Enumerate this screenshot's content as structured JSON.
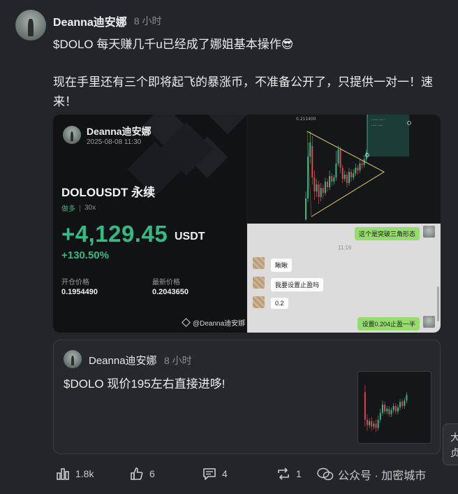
{
  "post": {
    "author": "Deanna迪安娜",
    "time": "8 小时",
    "line1": "$DOLO 每天赚几千u已经成了娜姐基本操作😎",
    "line2": "现在手里还有三个即将起飞的暴涨币，不准备公开了，只提供一对一！速来！"
  },
  "pnl_card": {
    "author": "Deanna迪安娜",
    "date": "2025-08-08 11:30",
    "pair": "DOLOUSDT 永续",
    "side": "做多",
    "leverage": "30x",
    "pnl": "+4,129.45",
    "unit": "USDT",
    "roi": "+130.50%",
    "entry_label": "开仓价格",
    "entry_value": "0.1954490",
    "last_label": "最新价格",
    "last_value": "0.2043650",
    "brand": "@Deanna迪安娜"
  },
  "chart_image": {
    "price_label": "0.211400",
    "chart_data": {
      "type": "candlestick",
      "annotation": "ascending triangle breakout"
    }
  },
  "chat": {
    "time": "11:16",
    "messages": [
      {
        "side": "right",
        "text": "这个是突破三角形态"
      },
      {
        "side": "left",
        "text": "瞅瞅"
      },
      {
        "side": "left",
        "text": "我要设置止盈吗"
      },
      {
        "side": "left",
        "text": "0.2"
      },
      {
        "side": "right",
        "text": "设置0.204止盈一半"
      }
    ]
  },
  "quote": {
    "author": "Deanna迪安娜",
    "time": "8 小时",
    "text": "$DOLO 现价195左右直接进哆!"
  },
  "actions": {
    "views": "1.8k",
    "likes": "6",
    "comments": "4",
    "reposts": "1"
  },
  "watermark": "公众号 · 加密城市",
  "side_button": "大 贞",
  "colors": {
    "background": "#232528",
    "profit_green": "#2ebd85",
    "chat_green": "#95dc6d"
  }
}
